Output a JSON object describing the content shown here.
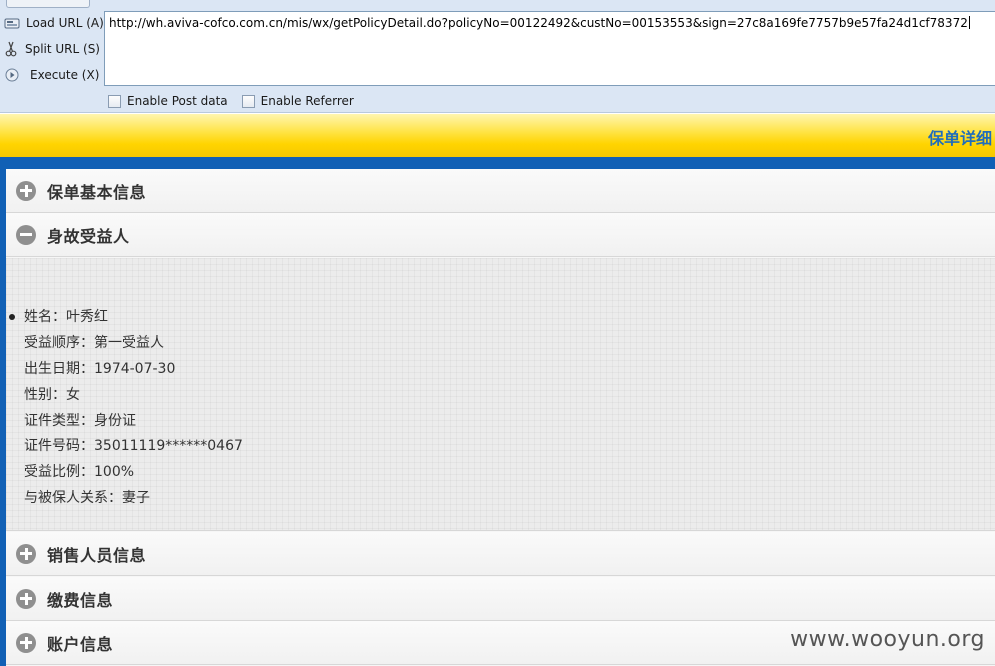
{
  "hackbar": {
    "actions": [
      {
        "label": "Load URL (A)",
        "icon": "load-url-icon"
      },
      {
        "label": "Split URL (S)",
        "icon": "split-url-icon"
      },
      {
        "label": "Execute (X)",
        "icon": "execute-icon"
      }
    ],
    "url": "http://wh.aviva-cofco.com.cn/mis/wx/getPolicyDetail.do?policyNo=00122492&custNo=00153553&sign=27c8a169fe7757b9e57fa24d1cf78372",
    "options": [
      {
        "label": "Enable Post data",
        "checked": false
      },
      {
        "label": "Enable Referrer",
        "checked": false
      }
    ]
  },
  "page": {
    "title": "保单详细",
    "sections": [
      {
        "title": "保单基本信息",
        "expanded": false
      },
      {
        "title": "身故受益人",
        "expanded": true
      },
      {
        "title": "销售人员信息",
        "expanded": false
      },
      {
        "title": "缴费信息",
        "expanded": false
      },
      {
        "title": "账户信息",
        "expanded": false
      }
    ],
    "beneficiary": [
      "姓名：叶秀红",
      "受益顺序：第一受益人",
      "出生日期：1974-07-30",
      "性别：女",
      "证件类型：身份证",
      "证件号码：35011119******0467",
      "受益比例：100%",
      "与被保人关系：妻子"
    ]
  },
  "watermark": "www.wooyun.org",
  "colors": {
    "accent_blue": "#1160b5",
    "header_yellow": "#ffd400",
    "title_blue": "#1f6dbb",
    "toolbar_bg": "#dbe6f4"
  }
}
